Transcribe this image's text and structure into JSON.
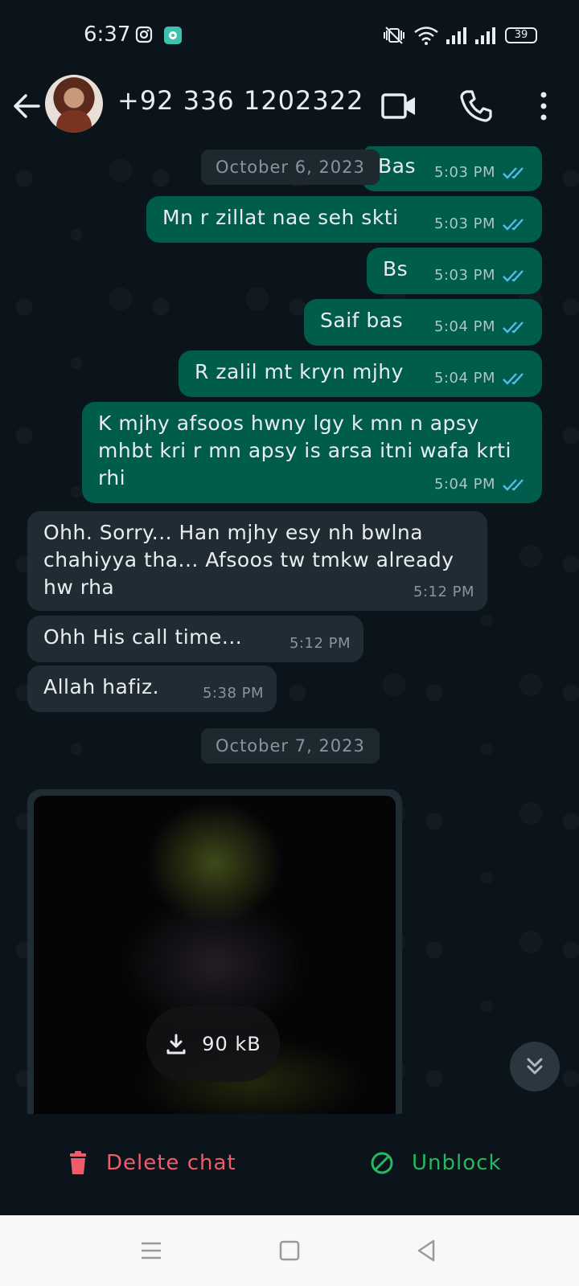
{
  "status_bar": {
    "time": "6:37",
    "battery": "39",
    "icons": [
      "instagram-icon",
      "app-notification-icon",
      "mute-vibrate-icon",
      "wifi-icon",
      "signal-icon",
      "signal-icon",
      "battery-icon"
    ]
  },
  "header": {
    "contact_name": "+92 336 1202322",
    "icons": [
      "back-arrow-icon",
      "video-call-icon",
      "voice-call-icon",
      "more-options-icon"
    ]
  },
  "chat": {
    "date_separators": [
      "October 6, 2023",
      "October 7, 2023"
    ],
    "messages": [
      {
        "direction": "out",
        "text": "Bas",
        "time": "5:03 PM",
        "read": true
      },
      {
        "direction": "out",
        "text": "Mn r zillat nae seh skti",
        "time": "5:03 PM",
        "read": true
      },
      {
        "direction": "out",
        "text": "Bs",
        "time": "5:03 PM",
        "read": true
      },
      {
        "direction": "out",
        "text": "Saif bas",
        "time": "5:04 PM",
        "read": true
      },
      {
        "direction": "out",
        "text": "R zalil mt kryn mjhy",
        "time": "5:04 PM",
        "read": true
      },
      {
        "direction": "out",
        "text": "K mjhy afsoos hwny lgy k mn n apsy mhbt kri r mn apsy is arsa itni wafa krti rhi",
        "time": "5:04 PM",
        "read": true
      },
      {
        "direction": "in",
        "text": "Ohh. Sorry... Han mjhy esy nh bwlna chahiyya tha... Afsoos tw tmkw already hw rha",
        "time": "5:12 PM"
      },
      {
        "direction": "in",
        "text": "Ohh His call time...",
        "time": "5:12 PM"
      },
      {
        "direction": "in",
        "text": "Allah hafiz.",
        "time": "5:38 PM"
      }
    ],
    "media": {
      "type": "image",
      "download_size": "90 kB"
    }
  },
  "footer": {
    "delete_label": "Delete chat",
    "unblock_label": "Unblock"
  },
  "colors": {
    "background": "#0b141a",
    "outgoing_bubble": "#005c4b",
    "incoming_bubble": "#202c33",
    "read_ticks": "#53bdeb",
    "delete": "#f15c6d",
    "unblock": "#25b85f"
  }
}
